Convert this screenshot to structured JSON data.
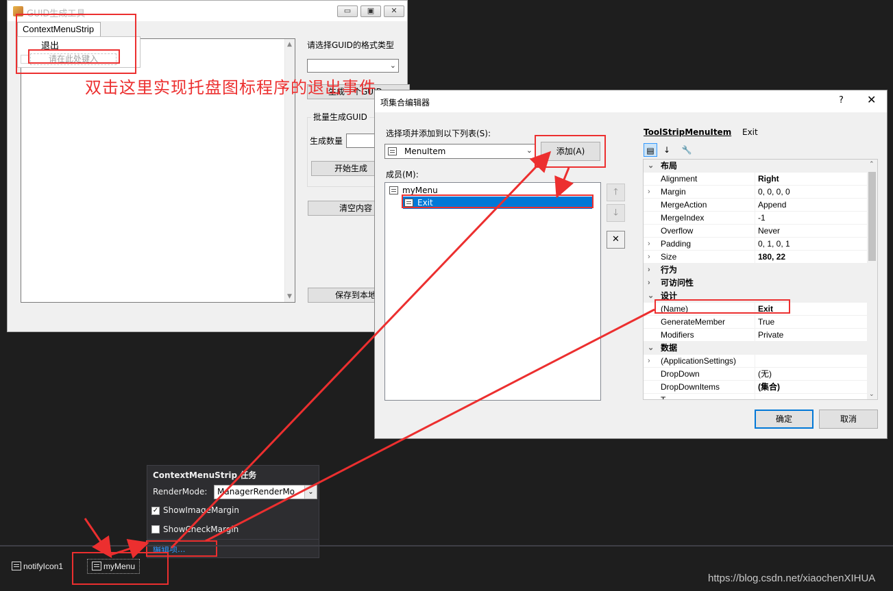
{
  "form": {
    "title": "GUID生成工具",
    "caption_minimize": "▭",
    "caption_maximize": "▣",
    "caption_close": "✕",
    "tab": "ContextMenuStrip",
    "menu_exit": "退出",
    "menu_typehere": "请在此处键入",
    "format_label": "请选择GUID的格式类型",
    "generate_one": "生成一个GUID",
    "batch_group": "批量生成GUID",
    "count_label": "生成数量",
    "start_generate": "开始生成",
    "clear_content": "清空内容",
    "save_local": "保存到本地"
  },
  "annotation": "双击这里实现托盘图标程序的退出事件",
  "editor": {
    "title": "项集合编辑器",
    "help": "?",
    "close": "✕",
    "select_label": "选择项并添加到以下列表(S):",
    "type_value": "MenuItem",
    "add_button": "添加(A)",
    "members_label": "成员(M):",
    "members": [
      {
        "label": "myMenu"
      },
      {
        "label": "Exit"
      }
    ],
    "move_up": "🡑",
    "move_down": "🡓",
    "delete": "✕",
    "prop_type": "ToolStripMenuItem",
    "prop_object": "Exit",
    "categorized_icon": "▤",
    "alphabetical_icon": "↓",
    "property_pages_icon": "🔧",
    "properties": [
      {
        "kind": "cat",
        "exp": "⌄",
        "name": "布局"
      },
      {
        "kind": "prop",
        "exp": "",
        "name": "Alignment",
        "value": "Right",
        "bold": true
      },
      {
        "kind": "prop",
        "exp": "›",
        "name": "Margin",
        "value": "0, 0, 0, 0",
        "bold": false
      },
      {
        "kind": "prop",
        "exp": "",
        "name": "MergeAction",
        "value": "Append",
        "bold": false
      },
      {
        "kind": "prop",
        "exp": "",
        "name": "MergeIndex",
        "value": "-1",
        "bold": false
      },
      {
        "kind": "prop",
        "exp": "",
        "name": "Overflow",
        "value": "Never",
        "bold": false
      },
      {
        "kind": "prop",
        "exp": "›",
        "name": "Padding",
        "value": "0, 1, 0, 1",
        "bold": false
      },
      {
        "kind": "prop",
        "exp": "›",
        "name": "Size",
        "value": "180, 22",
        "bold": true
      },
      {
        "kind": "cat",
        "exp": "›",
        "name": "行为"
      },
      {
        "kind": "cat",
        "exp": "›",
        "name": "可访问性"
      },
      {
        "kind": "cat",
        "exp": "⌄",
        "name": "设计"
      },
      {
        "kind": "prop",
        "exp": "",
        "name": "(Name)",
        "value": "Exit",
        "bold": true
      },
      {
        "kind": "prop",
        "exp": "",
        "name": "GenerateMember",
        "value": "True",
        "bold": false
      },
      {
        "kind": "prop",
        "exp": "",
        "name": "Modifiers",
        "value": "Private",
        "bold": false
      },
      {
        "kind": "cat",
        "exp": "⌄",
        "name": "数据"
      },
      {
        "kind": "prop",
        "exp": "›",
        "name": "(ApplicationSettings)",
        "value": "",
        "bold": false
      },
      {
        "kind": "prop",
        "exp": "",
        "name": "DropDown",
        "value": "(无)",
        "bold": false
      },
      {
        "kind": "prop",
        "exp": "",
        "name": "DropDownItems",
        "value": "(集合)",
        "bold": true
      },
      {
        "kind": "prop",
        "exp": "",
        "name": "T",
        "value": "",
        "bold": false
      }
    ],
    "ok": "确定",
    "cancel": "取消"
  },
  "tasks": {
    "title": "ContextMenuStrip 任务",
    "rendermode_label": "RenderMode:",
    "rendermode_value": "ManagerRenderMo",
    "show_image_margin": "ShowImageMargin",
    "show_image_margin_checked": true,
    "show_check_margin": "ShowCheckMargin",
    "show_check_margin_checked": false,
    "edit_items": "编辑项..."
  },
  "tray": {
    "notify_icon": "notifyIcon1",
    "menu": "myMenu"
  },
  "watermark": "https://blog.csdn.net/xiaochenXIHUA",
  "colors": {
    "annotation_red": "#ec2f2f",
    "selection_blue": "#0078d7",
    "dark_bg": "#1e1e1e",
    "link_blue": "#3399ff"
  }
}
